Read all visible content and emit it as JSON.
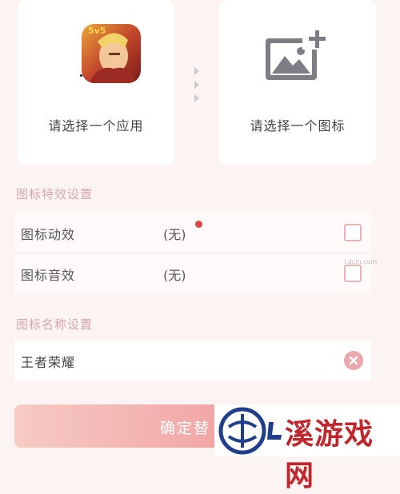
{
  "app_card": {
    "label": "请选择一个应用",
    "badge": "5v5"
  },
  "icon_card": {
    "label": "请选择一个图标"
  },
  "effects_section": {
    "title": "图标特效设置",
    "rows": [
      {
        "label": "图标动效",
        "value": "(无)"
      },
      {
        "label": "图标音效",
        "value": "(无)"
      }
    ]
  },
  "name_section": {
    "title": "图标名称设置",
    "value": "王者荣耀"
  },
  "confirm": {
    "label": "确定替"
  },
  "watermark": {
    "text": "溪游戏网",
    "url": "i.dcin.com"
  },
  "colors": {
    "accent": "#ef8f96",
    "section_title": "#d6a7ab",
    "checkbox_border": "#e9b3b8"
  },
  "icons": [
    "add-image-icon",
    "arrow-dots-icon",
    "clear-icon",
    "checkbox-icon"
  ]
}
